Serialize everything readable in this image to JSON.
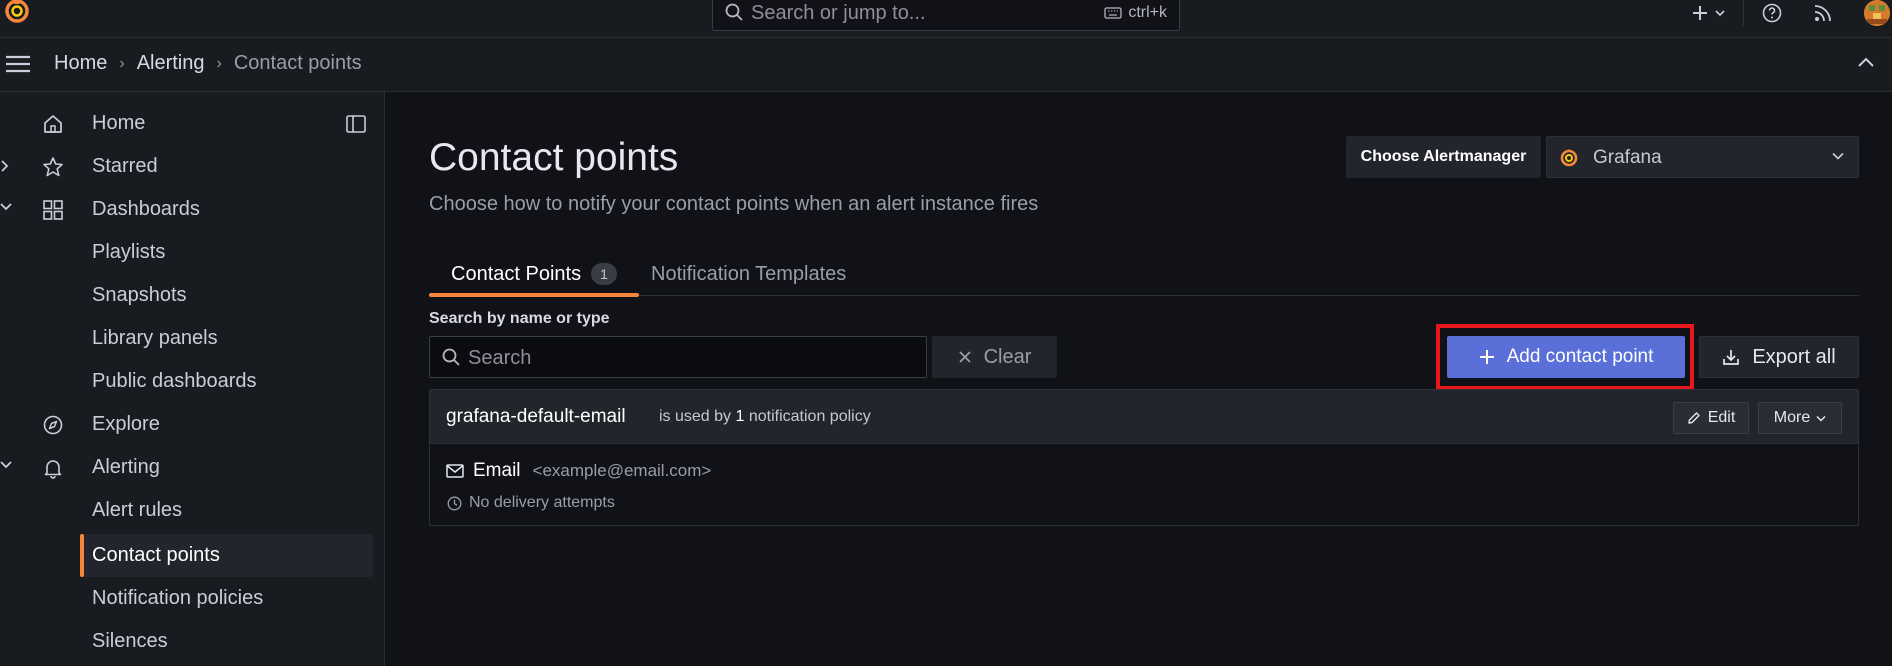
{
  "topbar": {
    "search_placeholder": "Search or jump to...",
    "shortcut": "ctrl+k"
  },
  "breadcrumb": {
    "items": [
      "Home",
      "Alerting",
      "Contact points"
    ]
  },
  "sidebar": {
    "items": [
      {
        "label": "Home",
        "icon": "home-icon"
      },
      {
        "label": "Starred",
        "icon": "star-icon"
      },
      {
        "label": "Dashboards",
        "icon": "apps-icon"
      },
      {
        "label": "Playlists"
      },
      {
        "label": "Snapshots"
      },
      {
        "label": "Library panels"
      },
      {
        "label": "Public dashboards"
      },
      {
        "label": "Explore",
        "icon": "compass-icon"
      },
      {
        "label": "Alerting",
        "icon": "bell-icon"
      },
      {
        "label": "Alert rules"
      },
      {
        "label": "Contact points",
        "active": true
      },
      {
        "label": "Notification policies"
      },
      {
        "label": "Silences"
      }
    ]
  },
  "main": {
    "title": "Contact points",
    "subtitle": "Choose how to notify your contact points when an alert instance fires",
    "alertmanager_label": "Choose Alertmanager",
    "alertmanager_value": "Grafana",
    "tabs": [
      {
        "label": "Contact Points",
        "count": "1",
        "active": true
      },
      {
        "label": "Notification Templates"
      }
    ],
    "search_label": "Search by name or type",
    "search_placeholder": "Search",
    "clear_label": "Clear",
    "add_label": "Add contact point",
    "export_label": "Export all",
    "contact_point": {
      "name": "grafana-default-email",
      "used_prefix": "is used by",
      "used_count": "1",
      "used_suffix": "notification policy",
      "edit_label": "Edit",
      "more_label": "More",
      "integration": "Email",
      "address": "<example@email.com>",
      "status": "No delivery attempts"
    }
  },
  "colors": {
    "accent_orange": "#f5863b",
    "primary_button": "#5a6fd8",
    "highlight_box": "#e8161d"
  }
}
